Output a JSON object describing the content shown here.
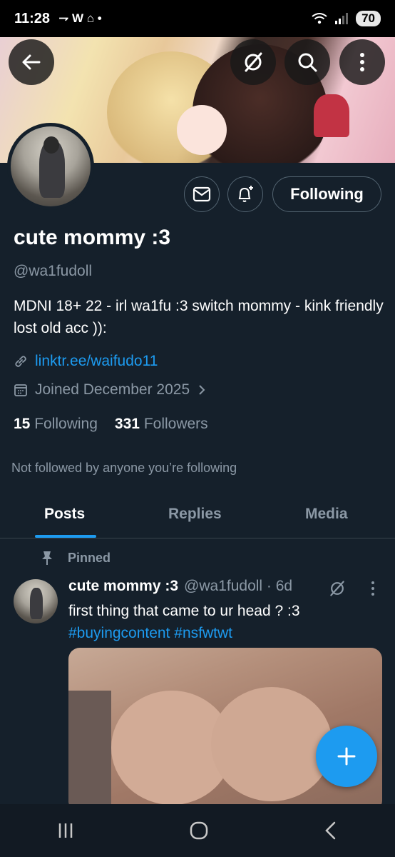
{
  "status_bar": {
    "time": "11:28",
    "notif_icons": "⇁ W ⌂ •",
    "battery": "70"
  },
  "profile": {
    "display_name": "cute mommy :3",
    "handle": "@wa1fudoll",
    "bio": "MDNI 18+ 22 - irl wa1fu :3 switch mommy - kink friendly lost old acc )):",
    "link": "linktr.ee/waifudo11",
    "joined": "Joined December 2025",
    "following_count": "15",
    "following_label": "Following",
    "followers_count": "331",
    "followers_label": "Followers",
    "not_followed": "Not followed by anyone you’re following",
    "follow_button": "Following"
  },
  "tabs": [
    {
      "label": "Posts"
    },
    {
      "label": "Replies"
    },
    {
      "label": "Media"
    }
  ],
  "post": {
    "pinned_label": "Pinned",
    "name": "cute mommy :3",
    "meta": "@wa1fudoll · 6d",
    "text": "first thing that came to ur head ? :3",
    "hashtags": "#buyingcontent #nsfwtwt"
  },
  "colors": {
    "background": "#15202b",
    "accent": "#1d9bf0",
    "muted": "#8b98a5"
  }
}
